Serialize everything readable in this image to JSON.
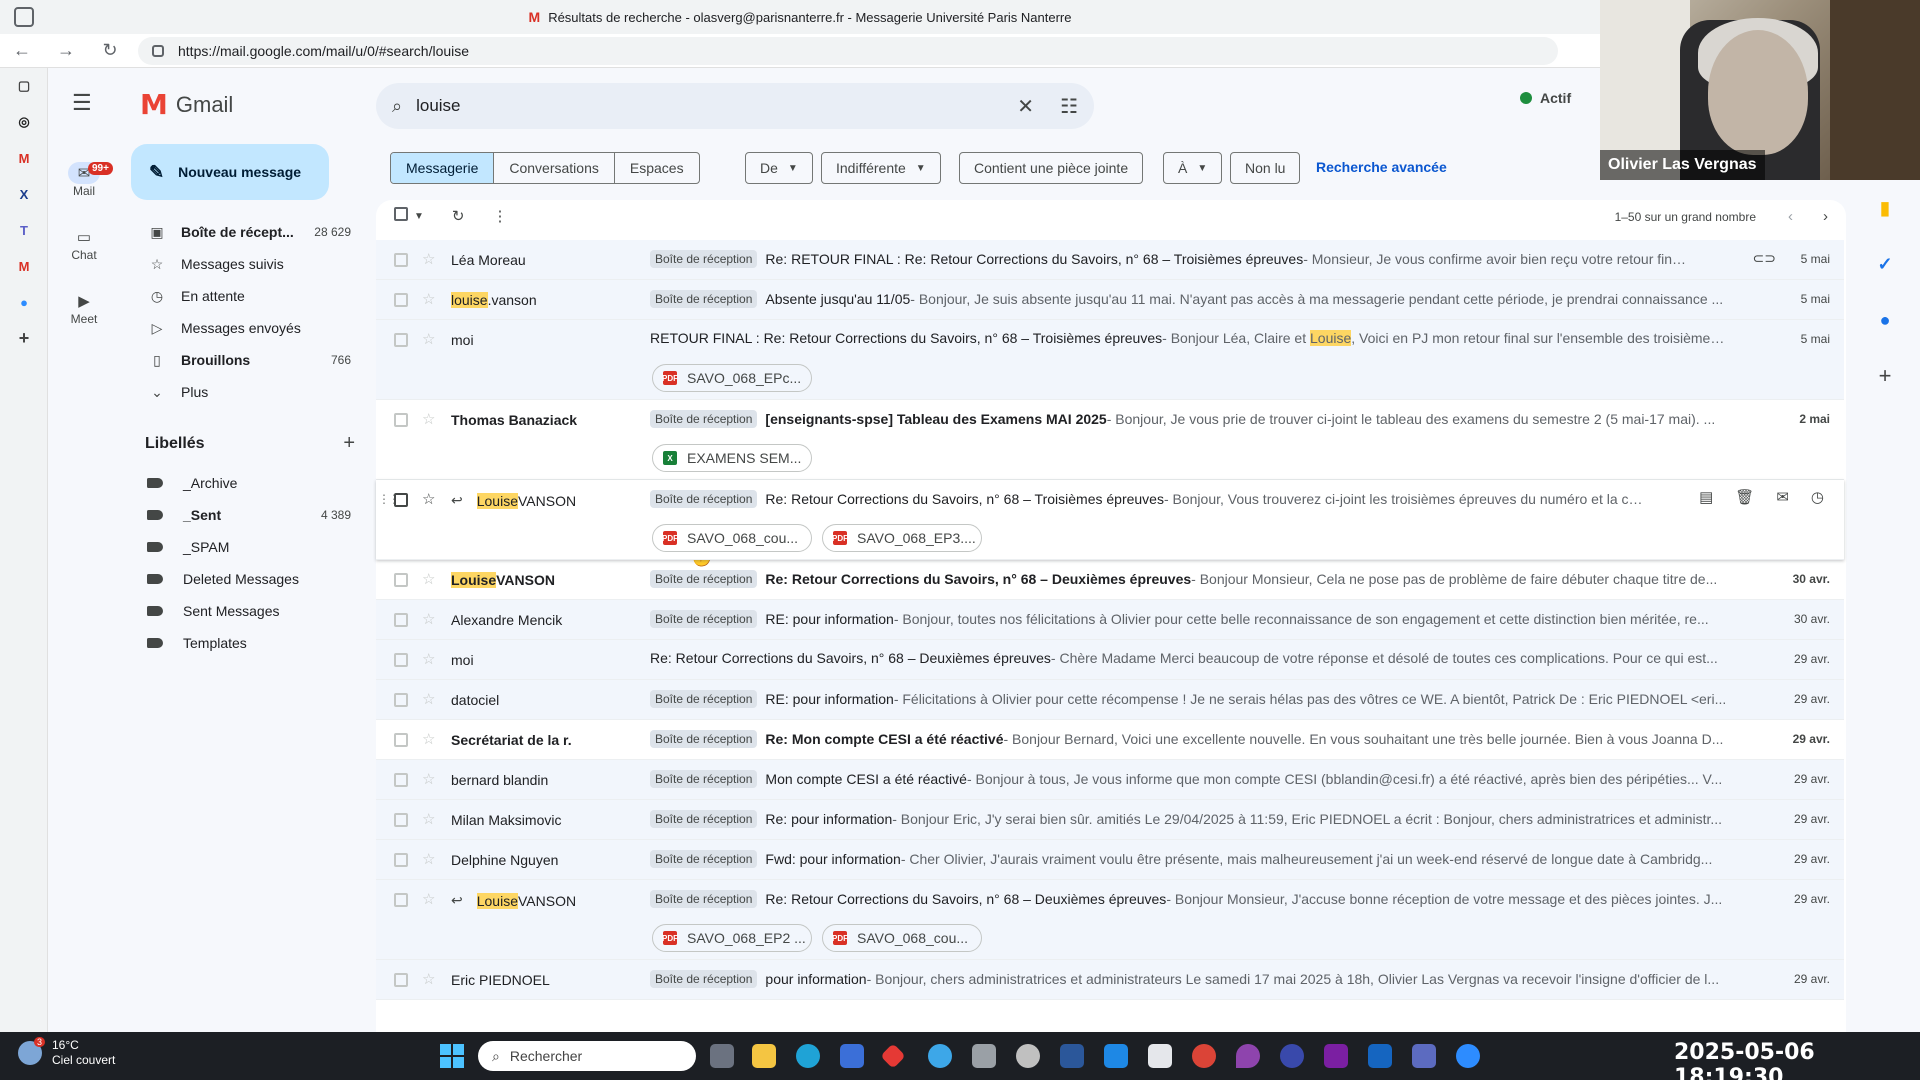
{
  "window": {
    "title": "Résultats de recherche - olasverg@parisnanterre.fr - Messagerie Université Paris Nanterre",
    "title_icon": "M",
    "url": "https://mail.google.com/mail/u/0/#search/louise"
  },
  "webcam": {
    "name": "Olivier Las Vergnas"
  },
  "rail": [
    {
      "label": "Mail",
      "icon": "mail-icon",
      "badge": "99+",
      "active": true
    },
    {
      "label": "Chat",
      "icon": "chat-icon"
    },
    {
      "label": "Meet",
      "icon": "video-icon"
    }
  ],
  "gmail": {
    "brand": "Gmail",
    "logo_letter": "M"
  },
  "compose": {
    "label": "Nouveau message"
  },
  "folders": [
    {
      "label": "Boîte de récept...",
      "count": "28 629",
      "icon": "inbox-icon",
      "bold": true
    },
    {
      "label": "Messages suivis",
      "count": "",
      "icon": "star-icon"
    },
    {
      "label": "En attente",
      "count": "",
      "icon": "clock-icon"
    },
    {
      "label": "Messages envoyés",
      "count": "",
      "icon": "send-icon"
    },
    {
      "label": "Brouillons",
      "count": "766",
      "icon": "draft-icon",
      "bold": true
    },
    {
      "label": "Plus",
      "count": "",
      "icon": "chevron-down-icon"
    }
  ],
  "labels": {
    "heading": "Libellés",
    "items": [
      {
        "label": "_Archive",
        "count": ""
      },
      {
        "label": "_Sent",
        "count": "4 389",
        "bold": true
      },
      {
        "label": "_SPAM",
        "count": ""
      },
      {
        "label": "Deleted Messages",
        "count": ""
      },
      {
        "label": "Sent Messages",
        "count": ""
      },
      {
        "label": "Templates",
        "count": ""
      }
    ]
  },
  "search": {
    "value": "louise"
  },
  "status": {
    "label": "Actif"
  },
  "filters": {
    "segments": [
      "Messagerie",
      "Conversations",
      "Espaces"
    ],
    "chips": [
      "De",
      "Indifférente",
      "Contient une pièce jointe",
      "À",
      "Non lu"
    ],
    "advanced": "Recherche avancée"
  },
  "paging": {
    "range": "1–50 sur un grand nombre"
  },
  "emails": [
    {
      "sender": "Léa Moreau",
      "tag": "Boîte de réception",
      "subject": "Re: RETOUR FINAL : Re: Retour Corrections du Savoirs, n° 68 – Troisièmes épreuves",
      "snippet": " - Monsieur, Je vous confirme avoir bien reçu votre retour final conce...",
      "date": "5 mai"
    },
    {
      "sender_hl": "louise",
      "sender_rest": ".vanson",
      "tag": "Boîte de réception",
      "subject": "Absente jusqu'au 11/05",
      "snippet": " - Bonjour, Je suis absente jusqu'au 11 mai. N'ayant pas accès à ma messagerie pendant cette période, je prendrai connaissance ...",
      "date": "5 mai"
    },
    {
      "sender": "moi",
      "subject": "RETOUR FINAL : Re: Retour Corrections du Savoirs, n° 68 – Troisièmes épreuves",
      "snippet_pre": " - Bonjour Léa, Claire et ",
      "snippet_hl": "Louise",
      "snippet_post": ", Voici en PJ mon retour final sur l'ensemble des troisièmes ...",
      "date": "5 mai",
      "attachments": [
        {
          "name": "SAVO_068_EPc...",
          "type": "PDF"
        }
      ]
    },
    {
      "sender": "Thomas Banaziack",
      "tag": "Boîte de réception",
      "subject": "[enseignants-spse] Tableau des Examens MAI 2025",
      "snippet": " - Bonjour, Je vous prie de trouver ci-joint le tableau des examens du semestre 2 (5 mai-17 mai). ...",
      "date": "2 mai",
      "attachments": [
        {
          "name": "EXAMENS SEM...",
          "type": "X"
        }
      ]
    },
    {
      "sender_hl": "Louise",
      "sender_rest": " VANSON",
      "tag": "Boîte de réception",
      "subject": "Re: Retour Corrections du Savoirs, n° 68 – Troisièmes épreuves",
      "snippet": " - Bonjour, Vous trouverez ci-joint les troisièmes épreuves du numéro et la cou...",
      "date": "",
      "attachments": [
        {
          "name": "SAVO_068_cou...",
          "type": "PDF"
        },
        {
          "name": "SAVO_068_EP3....",
          "type": "PDF"
        }
      ]
    },
    {
      "sender_hl": "Louise",
      "sender_rest": " VANSON",
      "tag": "Boîte de réception",
      "subject": "Re: Retour Corrections du Savoirs, n° 68 – Deuxièmes épreuves",
      "snippet": " - Bonjour Monsieur, Cela ne pose pas de problème de faire débuter chaque titre de...",
      "date": "30 avr."
    },
    {
      "sender": "Alexandre Mencik",
      "tag": "Boîte de réception",
      "subject": "RE: pour information",
      "snippet": " - Bonjour, toutes nos félicitations à Olivier pour cette belle reconnaissance de son engagement et cette distinction bien méritée, re...",
      "date": "30 avr."
    },
    {
      "sender": "moi",
      "subject": "Re: Retour Corrections du Savoirs, n° 68 – Deuxièmes épreuves",
      "snippet": " - Chère Madame Merci beaucoup de votre réponse et désolé de toutes ces complications. Pour ce qui est...",
      "date": "29 avr."
    },
    {
      "sender": "datociel",
      "tag": "Boîte de réception",
      "subject": "RE: pour information",
      "snippet": " - Félicitations à Olivier pour cette récompense ! Je ne serais hélas pas des vôtres ce WE. A bientôt, Patrick De : Eric PIEDNOEL <eri...",
      "date": "29 avr."
    },
    {
      "sender": "Secrétariat de la r.",
      "tag": "Boîte de réception",
      "subject": "Re: Mon compte CESI a été réactivé",
      "snippet": " - Bonjour Bernard, Voici une excellente nouvelle. En vous souhaitant une très belle journée. Bien à vous Joanna D...",
      "date": "29 avr."
    },
    {
      "sender": "bernard blandin",
      "tag": "Boîte de réception",
      "subject": "Mon compte CESI a été réactivé",
      "snippet": " - Bonjour à tous, Je vous informe que mon compte CESI (bblandin@cesi.fr) a été réactivé, après bien des péripéties... V...",
      "date": "29 avr."
    },
    {
      "sender": "Milan Maksimovic",
      "tag": "Boîte de réception",
      "subject": "Re: pour information",
      "snippet": " - Bonjour Eric, J'y serai bien sûr. amitiés Le 29/04/2025 à 11:59, Eric PIEDNOEL a écrit : Bonjour, chers administratrices et administr...",
      "date": "29 avr."
    },
    {
      "sender": "Delphine Nguyen",
      "tag": "Boîte de réception",
      "subject": "Fwd: pour information",
      "snippet": " - Cher Olivier, J'aurais vraiment voulu être présente, mais malheureusement j'ai un week-end réservé de longue date à Cambridg...",
      "date": "29 avr."
    },
    {
      "sender_hl": "Louise",
      "sender_rest": " VANSON",
      "tag": "Boîte de réception",
      "subject": "Re: Retour Corrections du Savoirs, n° 68 – Deuxièmes épreuves",
      "snippet": " - Bonjour Monsieur, J'accuse bonne réception de votre message et des pièces jointes. J...",
      "date": "29 avr.",
      "attachments": [
        {
          "name": "SAVO_068_EP2 ...",
          "type": "PDF"
        },
        {
          "name": "SAVO_068_cou...",
          "type": "PDF"
        }
      ]
    },
    {
      "sender": "Eric PIEDNOEL",
      "tag": "Boîte de réception",
      "subject": "pour information",
      "snippet": " - Bonjour, chers administratrices et administrateurs Le samedi 17 mai 2025 à 18h, Olivier Las Vergnas va recevoir l'insigne d'officier de l...",
      "date": "29 avr."
    }
  ],
  "taskbar": {
    "weather_temp": "16°C",
    "weather_desc": "Ciel couvert",
    "weather_badge": "3",
    "search_placeholder": "Rechercher",
    "clock": "2025-05-06  18:19:30"
  }
}
